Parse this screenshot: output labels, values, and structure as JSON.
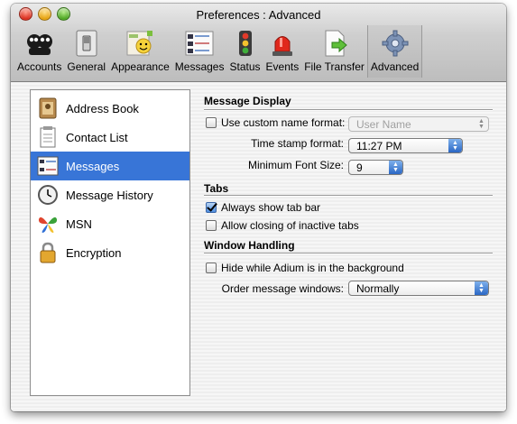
{
  "window": {
    "title": "Preferences : Advanced"
  },
  "toolbar": {
    "items": [
      {
        "label": "Accounts",
        "icon": "accounts-icon"
      },
      {
        "label": "General",
        "icon": "general-switch-icon"
      },
      {
        "label": "Appearance",
        "icon": "appearance-icon"
      },
      {
        "label": "Messages",
        "icon": "messages-icon"
      },
      {
        "label": "Status",
        "icon": "traffic-light-icon"
      },
      {
        "label": "Events",
        "icon": "siren-icon"
      },
      {
        "label": "File Transfer",
        "icon": "file-transfer-icon"
      },
      {
        "label": "Advanced",
        "icon": "gear-icon",
        "selected": true
      }
    ]
  },
  "sidebar": {
    "items": [
      {
        "label": "Address Book",
        "icon": "address-book-icon"
      },
      {
        "label": "Contact List",
        "icon": "contact-list-icon"
      },
      {
        "label": "Messages",
        "icon": "messages-icon",
        "selected": true
      },
      {
        "label": "Message History",
        "icon": "clock-icon"
      },
      {
        "label": "MSN",
        "icon": "msn-butterfly-icon"
      },
      {
        "label": "Encryption",
        "icon": "padlock-icon"
      }
    ]
  },
  "message_display": {
    "title": "Message Display",
    "custom_name": {
      "label": "Use custom name format:",
      "checked": false,
      "value": "User Name",
      "enabled": false
    },
    "timestamp": {
      "label": "Time stamp format:",
      "value": "11:27 PM"
    },
    "min_font": {
      "label": "Minimum Font Size:",
      "value": "9"
    }
  },
  "tabs": {
    "title": "Tabs",
    "always_show": {
      "label": "Always show tab bar",
      "checked": true
    },
    "allow_closing": {
      "label": "Allow closing of inactive tabs",
      "checked": false
    }
  },
  "window_handling": {
    "title": "Window Handling",
    "hide_bg": {
      "label": "Hide while Adium is in the background",
      "checked": false
    },
    "order": {
      "label": "Order message windows:",
      "value": "Normally"
    }
  },
  "colors": {
    "selection": "#3875d7",
    "popup_arrow": "#2a67c4"
  }
}
